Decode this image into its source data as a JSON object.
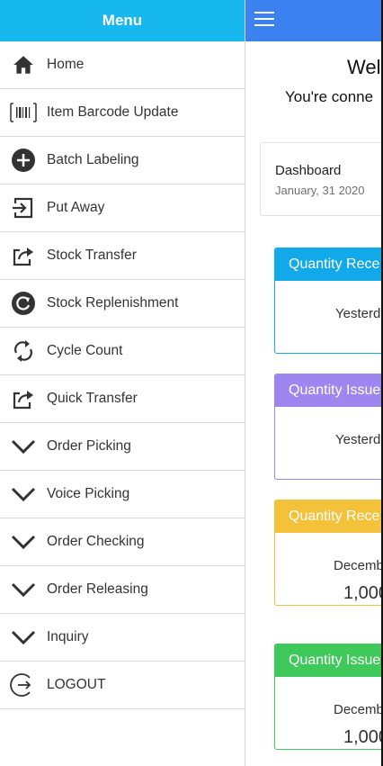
{
  "sidebar": {
    "title": "Menu",
    "items": [
      {
        "label": "Home",
        "icon": "home-icon"
      },
      {
        "label": "Item Barcode Update",
        "icon": "barcode-icon"
      },
      {
        "label": "Batch Labeling",
        "icon": "plus-circle-icon"
      },
      {
        "label": "Put Away",
        "icon": "sign-in-icon"
      },
      {
        "label": "Stock Transfer",
        "icon": "share-icon"
      },
      {
        "label": "Stock Replenishment",
        "icon": "refresh-circle-icon"
      },
      {
        "label": "Cycle Count",
        "icon": "sync-icon"
      },
      {
        "label": "Quick Transfer",
        "icon": "share-icon"
      },
      {
        "label": "Order Picking",
        "icon": "chevron-down-icon"
      },
      {
        "label": "Voice Picking",
        "icon": "chevron-down-icon"
      },
      {
        "label": "Order Checking",
        "icon": "chevron-down-icon"
      },
      {
        "label": "Order Releasing",
        "icon": "chevron-down-icon"
      },
      {
        "label": "Inquiry",
        "icon": "chevron-down-icon"
      },
      {
        "label": "LOGOUT",
        "icon": "logout-icon"
      }
    ]
  },
  "main": {
    "welcome": "Wel",
    "connected": "You're conne",
    "dashboard": {
      "title": "Dashboard",
      "date": "January, 31 2020"
    },
    "cards": [
      {
        "header": "Quantity Rece",
        "sub": "Yesterd",
        "value": "",
        "color": "#12a9ea"
      },
      {
        "header": "Quantity Issue",
        "sub": "Yesterd",
        "value": "",
        "color": "#9e86f0"
      },
      {
        "header": "Quantity Rece",
        "sub": "Decemb",
        "value": "1,000",
        "color": "#f4c13b"
      },
      {
        "header": "Quantity Issue",
        "sub": "Decemb",
        "value": "1,000",
        "color": "#3fc95a"
      }
    ]
  },
  "colors": {
    "menu_header": "#17b8ee",
    "topbar": "#3b82f0"
  }
}
